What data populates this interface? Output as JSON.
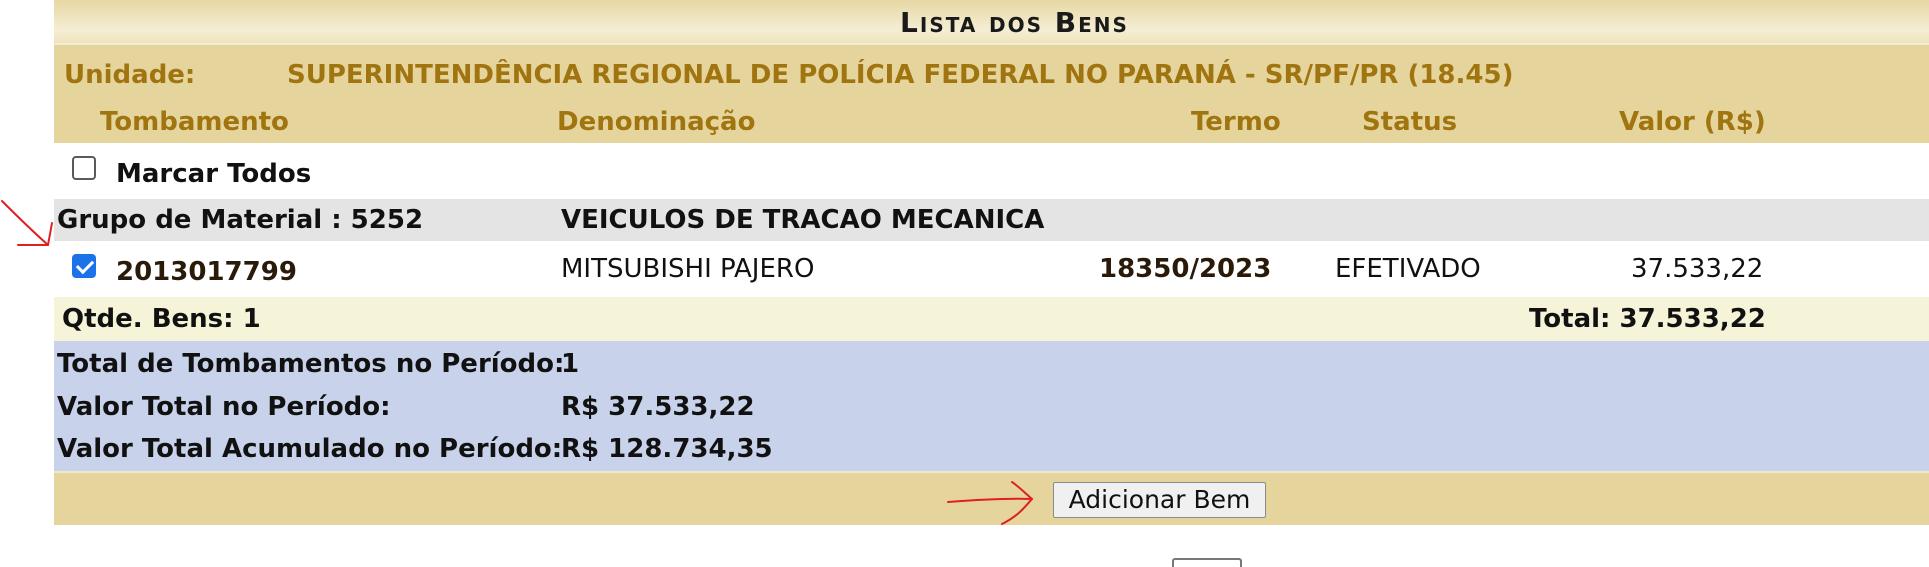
{
  "title": "Lista dos Bens",
  "unit": {
    "label": "Unidade:",
    "value": "SUPERINTENDÊNCIA REGIONAL DE POLÍCIA FEDERAL NO PARANÁ - SR/PF/PR (18.45)"
  },
  "columns": {
    "tombamento": "Tombamento",
    "denominacao": "Denominação",
    "termo": "Termo",
    "status": "Status",
    "valor": "Valor (R$)"
  },
  "mark_all": {
    "label": "Marcar Todos",
    "checked": false
  },
  "group": {
    "label": "Grupo de Material : 5252",
    "name": "VEICULOS DE TRACAO MECANICA"
  },
  "items": [
    {
      "checked": true,
      "tombamento": "2013017799",
      "denominacao": "MITSUBISHI PAJERO",
      "termo": "18350/2023",
      "status": "EFETIVADO",
      "valor": "37.533,22"
    }
  ],
  "subtotal": {
    "qty": "Qtde. Bens: 1",
    "total": "Total: 37.533,22"
  },
  "summary": {
    "total_tombamentos_label": "Total de Tombamentos no Período:",
    "total_tombamentos_value": "1",
    "valor_total_label": "Valor Total no Período:",
    "valor_total_value": "R$ 37.533,22",
    "valor_acumulado_label": "Valor Total Acumulado no Período:",
    "valor_acumulado_value": "R$ 128.734,35"
  },
  "actions": {
    "add_button": "Adicionar Bem"
  },
  "colors": {
    "header_bg": "#e5d59d",
    "header_text": "#a0740f",
    "group_bg": "#e5e4e5",
    "subtotal_bg": "#f5f3d8",
    "summary_bg": "#c8d2ea",
    "checkbox_checked": "#1a73e8",
    "annotation": "#e02020"
  }
}
